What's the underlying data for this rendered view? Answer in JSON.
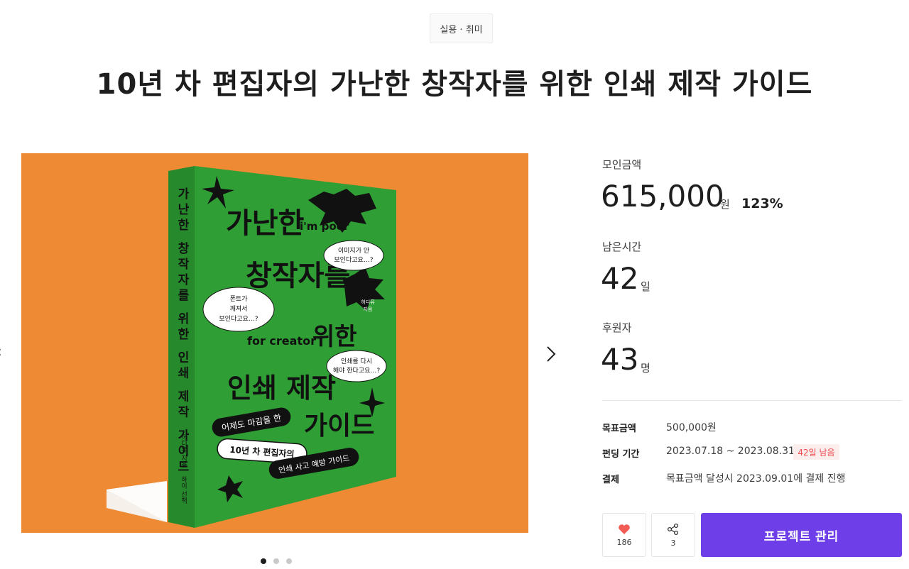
{
  "category": "실용 · 취미",
  "title": "10년 차 편집자의 가난한 창작자를 위한 인쇄 제작 가이드",
  "cover": {
    "spine_title": "가난한 창작자를 위한 인쇄 제작 가이드",
    "spine_author": "허디뮤 지음",
    "spine_publisher": "하이 선책",
    "title_line1": "가난한",
    "title_line1_sub": "i'm poor",
    "title_line2": "창작자를",
    "title_line3_sub": "for creator",
    "title_line3": "위한",
    "title_line4": "인쇄 제작",
    "title_line5": "가이드",
    "bubble_1a": "이미지가 안",
    "bubble_1b": "보인다고요…?",
    "bubble_2a": "폰트가",
    "bubble_2b": "깨져서",
    "bubble_2c": "보인다고요…?",
    "bubble_3a": "인쇄를 다시",
    "bubble_3b": "해야 한다고요…?",
    "badge_a": "허디뮤",
    "badge_b": "지음",
    "tag_1": "어제도 마감을 한",
    "tag_2": "10년 차 편집자의",
    "tag_3": "인쇄 사고 예방 가이드",
    "colors": {
      "background": "#ee8a33",
      "cover": "#2f9e35",
      "spine": "#268a2d"
    }
  },
  "stats": {
    "raised_label": "모인금액",
    "raised_value": "615,000",
    "raised_unit": "원",
    "raised_percent": "123%",
    "time_label": "남은시간",
    "time_value": "42",
    "time_unit": "일",
    "backers_label": "후원자",
    "backers_value": "43",
    "backers_unit": "명"
  },
  "info": {
    "goal_label": "목표금액",
    "goal_value": "500,000원",
    "period_label": "펀딩 기간",
    "period_value": "2023.07.18 ~ 2023.08.31",
    "period_badge": "42일 남음",
    "payment_label": "결제",
    "payment_value": "목표금액 달성시 2023.09.01에 결제 진행"
  },
  "actions": {
    "like_count": "186",
    "share_count": "3",
    "manage_label": "프로젝트 관리"
  },
  "icons": {
    "like": "heart-icon",
    "share": "share-icon",
    "next": "chevron-right-icon",
    "prev": "chevron-left-icon"
  },
  "accent_color": "#6e3ee8",
  "carousel": {
    "slides": 3,
    "active": 1
  }
}
